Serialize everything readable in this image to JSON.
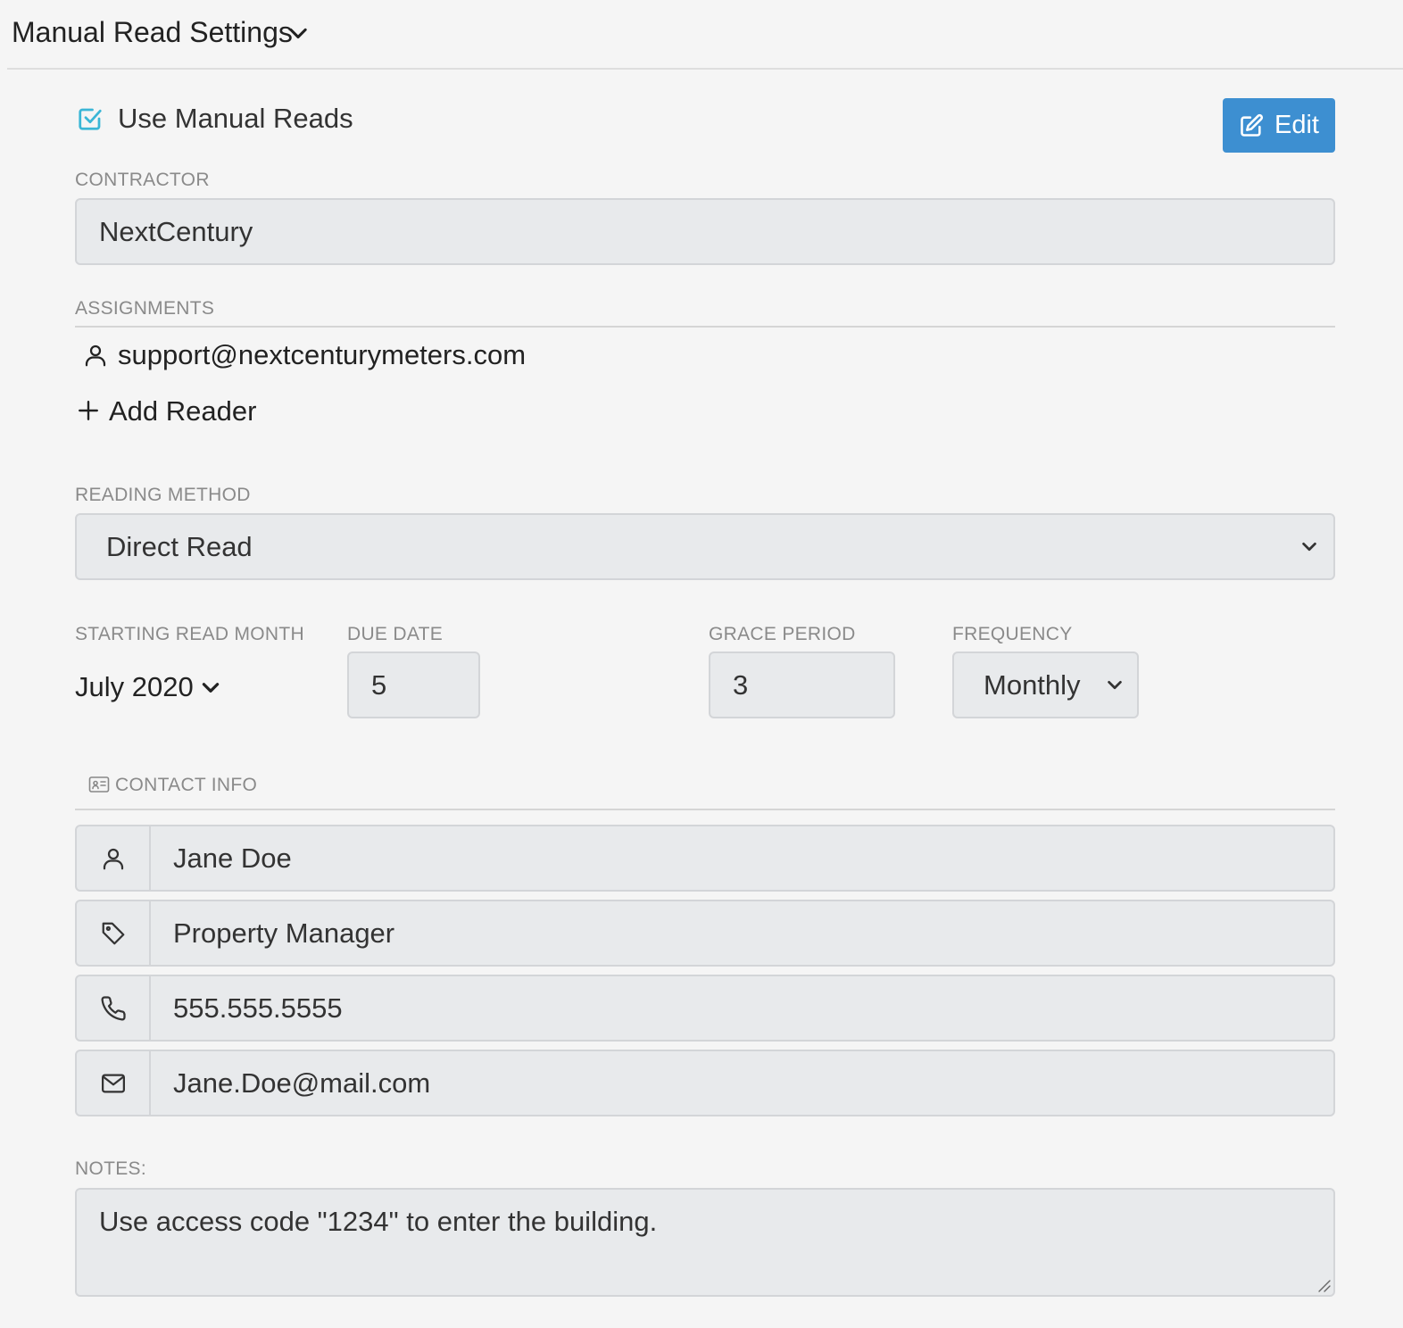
{
  "header": {
    "title": "Manual Read Settings",
    "chevron_icon": "chevron-down-icon"
  },
  "manual_reads": {
    "checked": true,
    "label": "Use Manual Reads",
    "check_color": "#3bb6d6"
  },
  "edit_button": {
    "label": "Edit",
    "icon": "edit-icon",
    "color": "#3d8fd1"
  },
  "contractor": {
    "label": "CONTRACTOR",
    "value": "NextCentury"
  },
  "assignments": {
    "label": "ASSIGNMENTS",
    "readers": [
      "support@nextcenturymeters.com"
    ],
    "add_label": "Add Reader"
  },
  "reading_method": {
    "label": "READING METHOD",
    "selected": "Direct Read"
  },
  "schedule": {
    "starting_month_label": "STARTING READ MONTH",
    "starting_month_value": "July 2020",
    "due_date_label": "DUE DATE",
    "due_date_value": "5",
    "grace_period_label": "GRACE PERIOD",
    "grace_period_value": "3",
    "frequency_label": "FREQUENCY",
    "frequency_value": "Monthly"
  },
  "contact": {
    "label": "CONTACT INFO",
    "name": "Jane Doe",
    "title": "Property Manager",
    "phone": "555.555.5555",
    "email": "Jane.Doe@mail.com"
  },
  "notes": {
    "label": "NOTES:",
    "value": "Use access code \"1234\" to enter the building."
  }
}
